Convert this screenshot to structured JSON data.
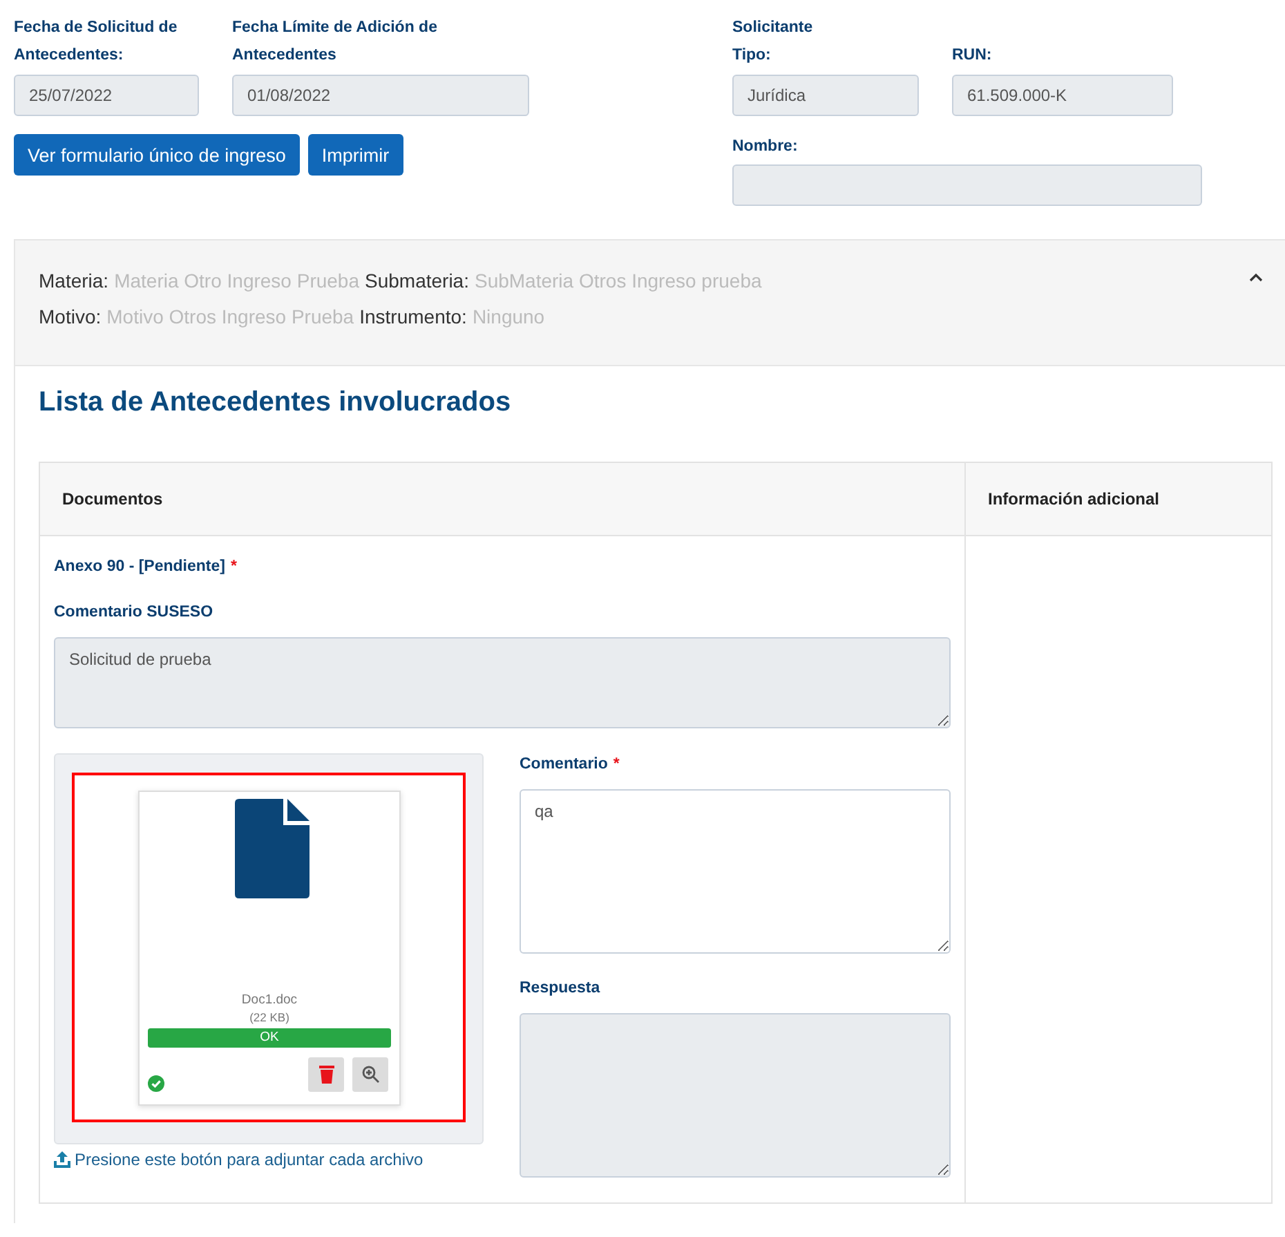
{
  "dates": [
    {
      "label": "Fecha de Solicitud de Antecedentes:",
      "value": "25/07/2022"
    },
    {
      "label": "Fecha Límite de Adición de Antecedentes",
      "value": "01/08/2022"
    }
  ],
  "buttons": [
    "Ver formulario único de ingreso",
    "Imprimir"
  ],
  "applicant": {
    "heading": "Solicitante",
    "fields": [
      {
        "label": "Tipo:",
        "value": "Jurídica"
      },
      {
        "label": "RUN:",
        "value": "61.509.000-K"
      }
    ],
    "name_label": "Nombre:"
  },
  "summary": {
    "expanded": true,
    "lines": [
      [
        {
          "label": "Materia:",
          "value": "Materia Otro Ingreso Prueba"
        },
        {
          "label": "Submateria:",
          "value": "SubMateria Otros Ingreso prueba"
        }
      ],
      [
        {
          "label": "Motivo:",
          "value": "Motivo Otros Ingreso Prueba"
        },
        {
          "label": "Instrumento:",
          "value": "Ninguno"
        }
      ]
    ]
  },
  "section_title": "Lista de Antecedentes involucrados",
  "table": {
    "columns": [
      "Documentos",
      "Información adicional"
    ],
    "rows": [
      {
        "document": "Anexo 90 - [Pendiente]",
        "required_mark": "*",
        "comment_label": "Comentario SUSESO",
        "comment": "Solicitud de prueba",
        "file": {
          "name": "Doc1.doc",
          "size": "(22 KB)",
          "status": "OK",
          "level": 1,
          "uploaded": true
        },
        "upload_hint": "Presione este botón para adjuntar cada archivo",
        "fields": [
          {
            "label": "Comentario",
            "required_mark": "*",
            "value": "qa",
            "disabled": false
          },
          {
            "label": "Respuesta",
            "disabled": true
          }
        ]
      }
    ]
  }
}
